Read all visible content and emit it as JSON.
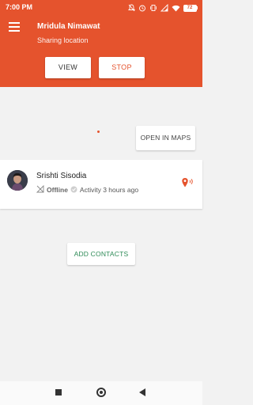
{
  "status_bar": {
    "time": "7:00 PM",
    "battery": "72",
    "icons": [
      "mute-icon",
      "alarm-icon",
      "vibrate-icon",
      "signal-icon",
      "wifi-icon",
      "battery-icon"
    ]
  },
  "header": {
    "user_name": "Mridula Nimawat",
    "status_text": "Sharing location",
    "view_label": "VIEW",
    "stop_label": "STOP"
  },
  "map": {
    "open_maps_label": "OPEN IN MAPS"
  },
  "contacts": [
    {
      "name": "Srishti Sisodia",
      "presence": "Offline",
      "activity": "Activity 3 hours ago"
    }
  ],
  "add_contacts_label": "ADD CONTACTS",
  "colors": {
    "accent": "#e5532d",
    "add_button_text": "#2e8b57"
  }
}
